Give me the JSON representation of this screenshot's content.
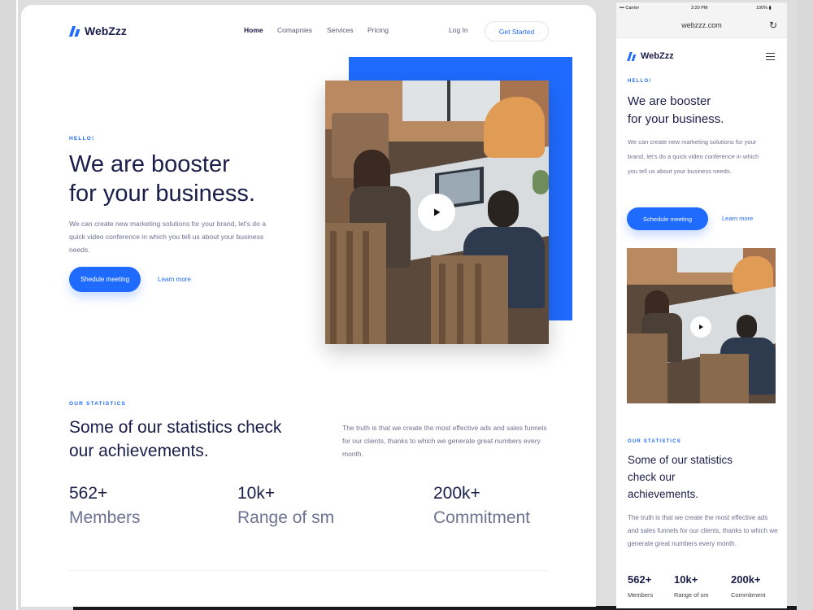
{
  "colors": {
    "accent": "#1f6bff",
    "heading": "#1b1d4a",
    "body": "#6e7191"
  },
  "brand": {
    "name": "WebZzz",
    "logo_icon": "webzzz-logo-icon"
  },
  "nav": {
    "items": [
      {
        "label": "Home",
        "active": true
      },
      {
        "label": "Comapnies",
        "active": false
      },
      {
        "label": "Services",
        "active": false
      },
      {
        "label": "Pricing",
        "active": false
      }
    ],
    "login": "Log In",
    "get_started": "Get Started"
  },
  "hero": {
    "eyebrow": "HELLO!",
    "title_line1": "We are booster",
    "title_line2": "for your business.",
    "description": "We can create new marketing solutions for your brand, let's do a quick video conference in which you tell us about your business needs.",
    "desktop_primary": "Shedule meeting",
    "mobile_primary": "Schedule meeting",
    "secondary": "Learn more",
    "video_icon": "play-icon"
  },
  "stats": {
    "eyebrow": "OUR STATISTICS",
    "title_line1": "Some of our statistics check",
    "title_line2": "our achievements.",
    "mobile_title_line1": "Some of our statistics",
    "mobile_title_line2": "check our",
    "mobile_title_line3": "achievements.",
    "description": "The truth is that we create the most effective ads and sales funnels for our clients, thanks to which we generate great numbers every month.",
    "items": [
      {
        "value": "562+",
        "label": "Members"
      },
      {
        "value": "10k+",
        "label": "Range of sm"
      },
      {
        "value": "200k+",
        "label": "Commitment"
      }
    ]
  },
  "mobile": {
    "status": {
      "carrier": "Carrier",
      "time": "3:20 PM",
      "battery": "100%"
    },
    "url": "webzzz.com",
    "menu_icon": "hamburger-icon",
    "reload_icon": "reload-icon"
  }
}
